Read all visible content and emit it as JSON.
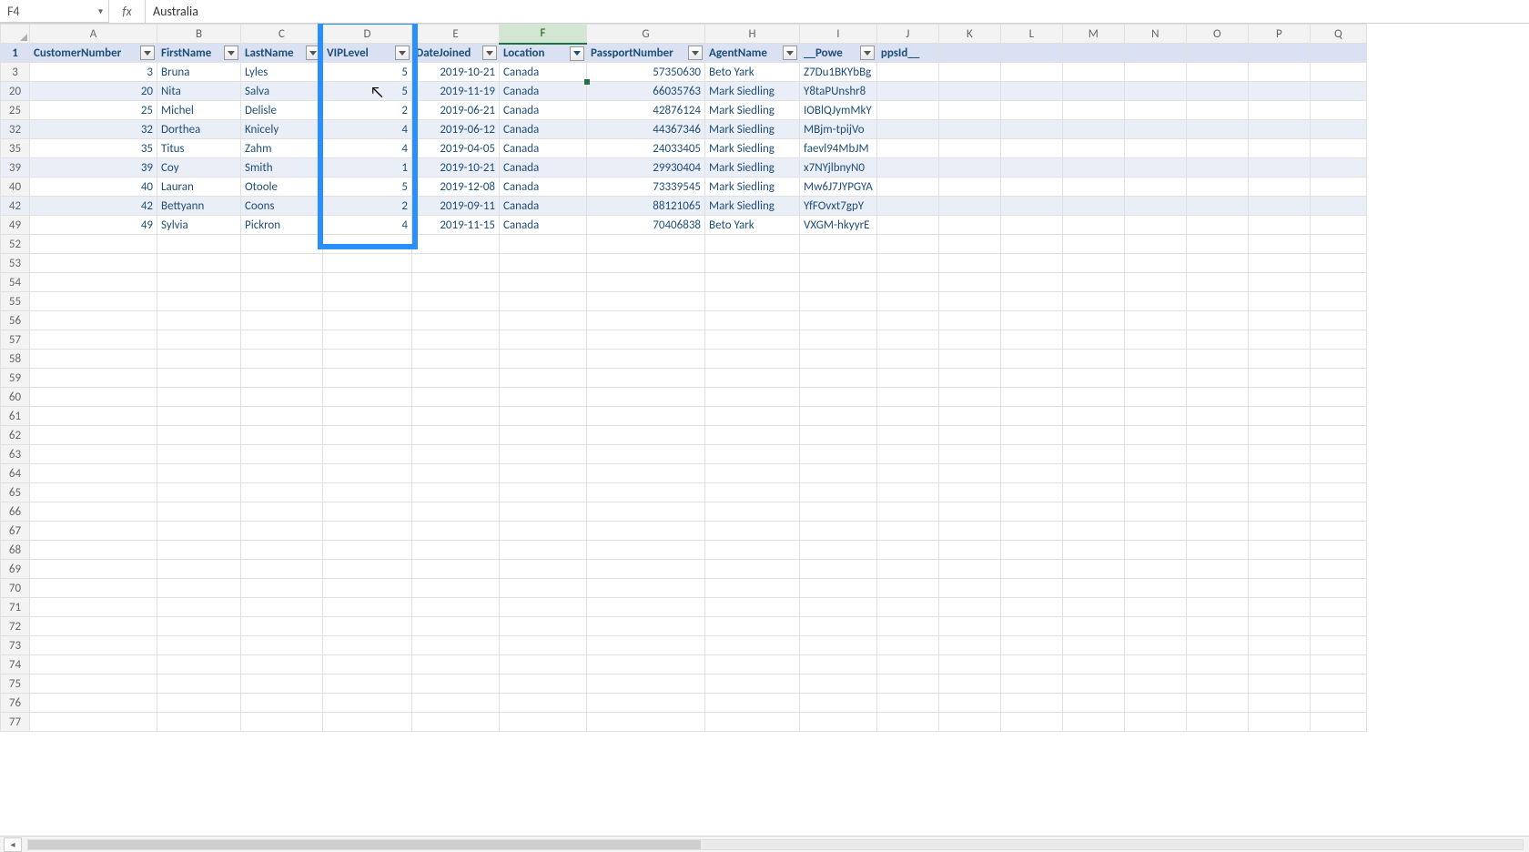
{
  "formula_bar": {
    "cell_ref": "F4",
    "fx_label": "fx",
    "value": "Australia"
  },
  "columns": [
    "A",
    "B",
    "C",
    "D",
    "E",
    "F",
    "G",
    "H",
    "I",
    "J",
    "K",
    "L",
    "M",
    "N",
    "O",
    "P",
    "Q"
  ],
  "selected_column": "F",
  "row_headers_visible": [
    1,
    3,
    20,
    25,
    32,
    35,
    39,
    40,
    42,
    49,
    52,
    53,
    54,
    55,
    56,
    57,
    58,
    59,
    60,
    61,
    62,
    63,
    64,
    65,
    66,
    67,
    68,
    69,
    70,
    71,
    72,
    73,
    74,
    75,
    76,
    77
  ],
  "table": {
    "headers": [
      "CustomerNumber",
      "FirstName",
      "LastName",
      "VIPLevel",
      "DateJoined",
      "Location",
      "PassportNumber",
      "AgentName",
      "__Powe",
      "ppsId__"
    ],
    "filtered_columns": [
      "Location"
    ],
    "rows": [
      {
        "row": 3,
        "CustomerNumber": 3,
        "FirstName": "Bruna",
        "LastName": "Lyles",
        "VIPLevel": 5,
        "DateJoined": "2019-10-21",
        "Location": "Canada",
        "PassportNumber": 57350630,
        "AgentName": "Beto Yark",
        "Powe": "Z7Du1BKYbBg"
      },
      {
        "row": 20,
        "CustomerNumber": 20,
        "FirstName": "Nita",
        "LastName": "Salva",
        "VIPLevel": 5,
        "DateJoined": "2019-11-19",
        "Location": "Canada",
        "PassportNumber": 66035763,
        "AgentName": "Mark Siedling",
        "Powe": "Y8taPUnshr8"
      },
      {
        "row": 25,
        "CustomerNumber": 25,
        "FirstName": "Michel",
        "LastName": "Delisle",
        "VIPLevel": 2,
        "DateJoined": "2019-06-21",
        "Location": "Canada",
        "PassportNumber": 42876124,
        "AgentName": "Mark Siedling",
        "Powe": "IOBlQJymMkY"
      },
      {
        "row": 32,
        "CustomerNumber": 32,
        "FirstName": "Dorthea",
        "LastName": "Knicely",
        "VIPLevel": 4,
        "DateJoined": "2019-06-12",
        "Location": "Canada",
        "PassportNumber": 44367346,
        "AgentName": "Mark Siedling",
        "Powe": "MBjm-tpijVo"
      },
      {
        "row": 35,
        "CustomerNumber": 35,
        "FirstName": "Titus",
        "LastName": "Zahm",
        "VIPLevel": 4,
        "DateJoined": "2019-04-05",
        "Location": "Canada",
        "PassportNumber": 24033405,
        "AgentName": "Mark Siedling",
        "Powe": "faevl94MbJM"
      },
      {
        "row": 39,
        "CustomerNumber": 39,
        "FirstName": "Coy",
        "LastName": "Smith",
        "VIPLevel": 1,
        "DateJoined": "2019-10-21",
        "Location": "Canada",
        "PassportNumber": 29930404,
        "AgentName": "Mark Siedling",
        "Powe": "x7NYjlbnyN0"
      },
      {
        "row": 40,
        "CustomerNumber": 40,
        "FirstName": "Lauran",
        "LastName": "Otoole",
        "VIPLevel": 5,
        "DateJoined": "2019-12-08",
        "Location": "Canada",
        "PassportNumber": 73339545,
        "AgentName": "Mark Siedling",
        "Powe": "Mw6J7JYPGYA"
      },
      {
        "row": 42,
        "CustomerNumber": 42,
        "FirstName": "Bettyann",
        "LastName": "Coons",
        "VIPLevel": 2,
        "DateJoined": "2019-09-11",
        "Location": "Canada",
        "PassportNumber": 88121065,
        "AgentName": "Mark Siedling",
        "Powe": "YfFOvxt7gpY"
      },
      {
        "row": 49,
        "CustomerNumber": 49,
        "FirstName": "Sylvia",
        "LastName": "Pickron",
        "VIPLevel": 4,
        "DateJoined": "2019-11-15",
        "Location": "Canada",
        "PassportNumber": 70406838,
        "AgentName": "Beto Yark",
        "Powe": "VXGM-hkyyrE"
      }
    ]
  },
  "highlight": {
    "column_header": "VIPLevel"
  },
  "cursor_note": "mouse pointer near D row 20"
}
